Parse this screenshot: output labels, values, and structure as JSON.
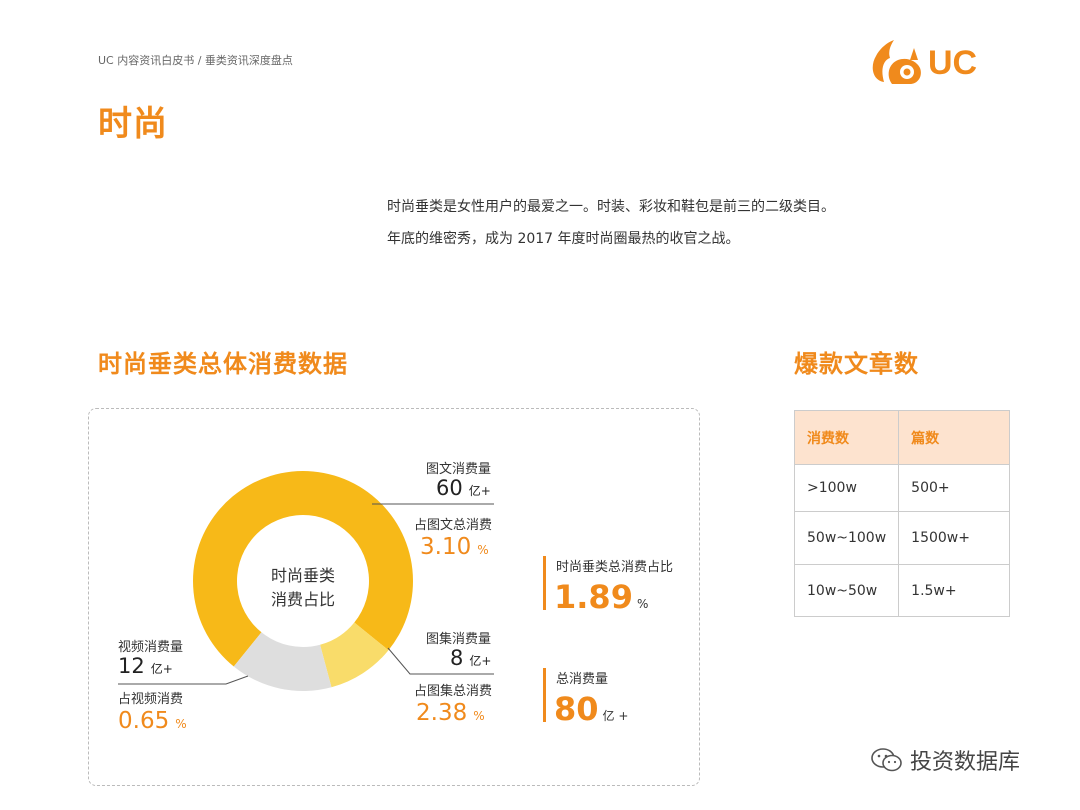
{
  "header": {
    "breadcrumb": "UC 内容资讯白皮书 / 垂类资讯深度盘点",
    "title": "时尚",
    "logo_text": "UC"
  },
  "intro": {
    "line1": "时尚垂类是女性用户的最爱之一。时装、彩妆和鞋包是前三的二级类目。",
    "line2": "年底的维密秀，成为 2017 年度时尚圈最热的收官之战。"
  },
  "consumption": {
    "section_title": "时尚垂类总体消费数据",
    "donut_center_line1": "时尚垂类",
    "donut_center_line2": "消费占比",
    "text_block": {
      "label": "图文消费量",
      "value": "60",
      "unit": "亿+",
      "share_label": "占图文总消费",
      "share_value": "3.10",
      "share_unit": "%"
    },
    "gallery_block": {
      "label": "图集消费量",
      "value": "8",
      "unit": "亿+",
      "share_label": "占图集总消费",
      "share_value": "2.38",
      "share_unit": "%"
    },
    "video_block": {
      "label": "视频消费量",
      "value": "12",
      "unit": "亿+",
      "share_label": "占视频消费",
      "share_value": "0.65",
      "share_unit": "%"
    },
    "total_share": {
      "label": "时尚垂类总消费占比",
      "value": "1.89",
      "unit": "%"
    },
    "total_volume": {
      "label": "总消费量",
      "value": "80",
      "unit": "亿 +"
    }
  },
  "chart_data": {
    "type": "pie",
    "categories": [
      "图文",
      "图集",
      "视频"
    ],
    "values": [
      60,
      8,
      12
    ],
    "colors": [
      "#f7b918",
      "#f9dc6a",
      "#dedede"
    ]
  },
  "hits_table": {
    "section_title": "爆款文章数",
    "headers": [
      "消费数",
      "篇数"
    ],
    "rows": [
      [
        ">100w",
        "500+"
      ],
      [
        "50w~100w",
        "1500w+"
      ],
      [
        "10w~50w",
        "1.5w+"
      ]
    ]
  },
  "watermark": "投资数据库"
}
